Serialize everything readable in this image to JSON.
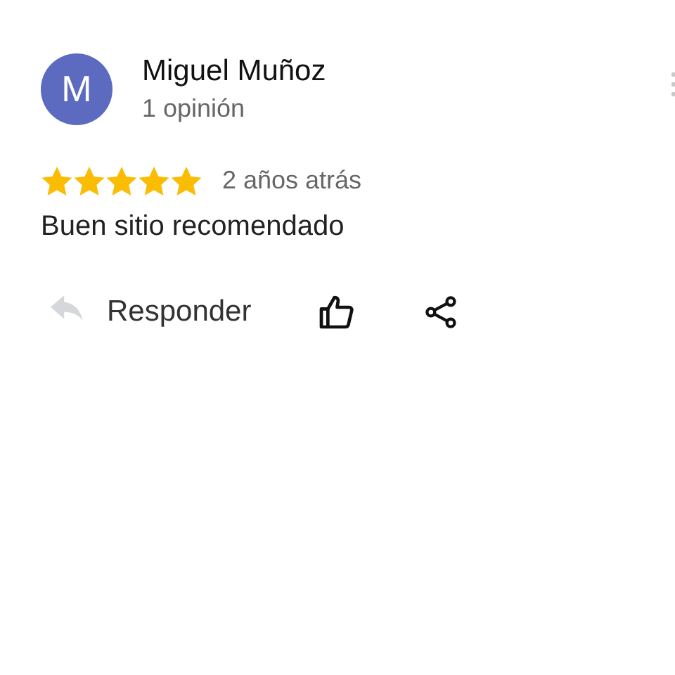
{
  "review": {
    "avatar_letter": "M",
    "author": "Miguel Muñoz",
    "review_count": "1 opinión",
    "stars": 5,
    "time": "2 años atrás",
    "text": "Buen sitio recomendado"
  },
  "actions": {
    "reply_label": "Responder"
  }
}
